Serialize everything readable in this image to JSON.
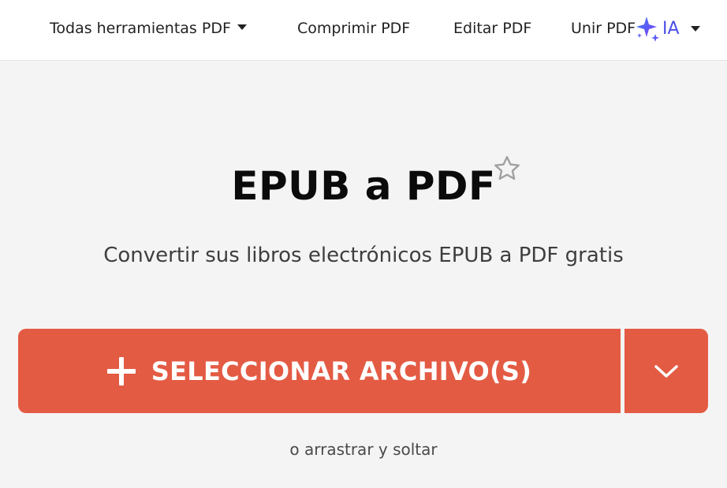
{
  "nav": {
    "items": [
      {
        "label": "Todas herramientas PDF",
        "has_dropdown": true
      },
      {
        "label": "Comprimir PDF"
      },
      {
        "label": "Editar PDF"
      },
      {
        "label": "Unir PDF"
      }
    ],
    "ai": {
      "label": "IA",
      "icon": "sparkle-icon",
      "color": "#4b4ee8"
    }
  },
  "main": {
    "title": "EPUB a PDF",
    "favorite_icon": "star-outline-icon",
    "subtitle": "Convertir sus libros electrónicos EPUB a PDF gratis",
    "upload_button": {
      "label": "SELECCIONAR ARCHIVO(S)",
      "icon": "plus-icon",
      "color": "#e45b44"
    },
    "upload_options_icon": "chevron-down-icon",
    "drop_hint": "o arrastrar y soltar"
  }
}
